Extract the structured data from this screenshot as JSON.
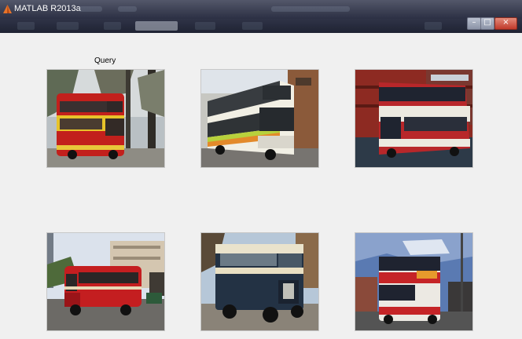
{
  "window": {
    "title": "MATLAB R2013a"
  },
  "query": {
    "label": "Query"
  },
  "images": [
    {
      "name": "query-image-bus-red-yellow",
      "description_icon": "bus-image"
    },
    {
      "name": "result-image-bus-white-green",
      "description_icon": "bus-image"
    },
    {
      "name": "result-image-bus-red-white",
      "description_icon": "bus-image"
    },
    {
      "name": "result-image-bus-red-vintage",
      "description_icon": "bus-image"
    },
    {
      "name": "result-image-bus-blue-vintage",
      "description_icon": "bus-image"
    },
    {
      "name": "result-image-bus-red-white-street",
      "description_icon": "bus-image"
    }
  ],
  "colors": {
    "titlebar": "#3b3f52",
    "menubar": "#1f2333",
    "background": "#f0f0f0",
    "close_button": "#c0392b"
  }
}
